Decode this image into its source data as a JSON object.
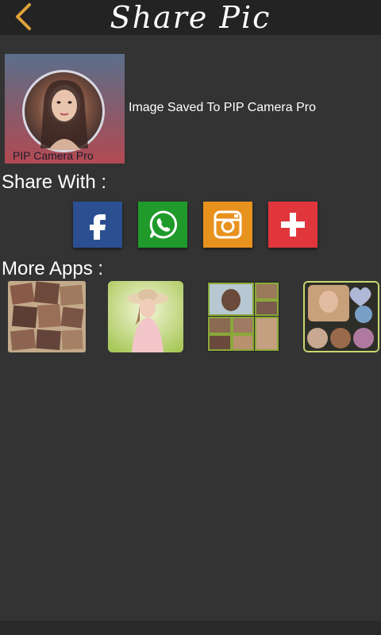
{
  "header": {
    "title": "Share Pic",
    "back_icon": "chevron-left-icon",
    "accent": "#e0a23a"
  },
  "saved": {
    "preview_caption": "PIP Camera Pro",
    "message": "Image Saved To PIP Camera Pro"
  },
  "share": {
    "label": "Share With :",
    "buttons": [
      {
        "name": "facebook",
        "icon": "facebook-icon",
        "color": "#2b4f91"
      },
      {
        "name": "whatsapp",
        "icon": "whatsapp-icon",
        "color": "#1f9a2b"
      },
      {
        "name": "instagram",
        "icon": "instagram-icon",
        "color": "#e8921e"
      },
      {
        "name": "more",
        "icon": "plus-icon",
        "color": "#e0363c"
      }
    ]
  },
  "more_apps": {
    "label": "More Apps :"
  }
}
